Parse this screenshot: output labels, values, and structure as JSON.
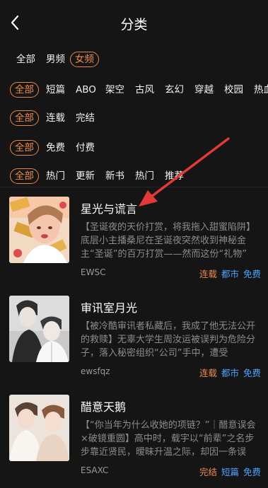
{
  "header": {
    "title": "分类",
    "back_icon": "chevron-left-icon"
  },
  "filters": {
    "gender": [
      "全部",
      "男频",
      "女频"
    ],
    "genre": [
      "全部",
      "短篇",
      "ABO",
      "架空",
      "古风",
      "玄幻",
      "穿越",
      "校园",
      "热血"
    ],
    "status": [
      "全部",
      "连载",
      "完结"
    ],
    "price": [
      "全部",
      "免费",
      "付费"
    ],
    "sort": [
      "全部",
      "热门",
      "更新",
      "新书",
      "热门",
      "推荐"
    ]
  },
  "books": [
    {
      "title": "星光与谎言",
      "desc": "【圣诞夜的天价打赏，将我拖入甜蜜陷阱】底层小主播桑尼在圣诞夜突然收到神秘金主“圣诞”的百万打赏——然而这份“礼物”",
      "author": "EWSC",
      "tags": [
        "连载",
        "都市",
        "免费"
      ]
    },
    {
      "title": "审讯室月光",
      "desc": "【被冷酷审讯者私藏后，我成了他无法公开的救赎】无辜大学生周汝运被误判为危险分子，落入秘密组织“公司”手中，遭受",
      "author": "ewsfqz",
      "tags": [
        "连载",
        "都市",
        "免费"
      ]
    },
    {
      "title": "醋意天鹅",
      "desc": "【“你当年为什么收她的项链？”｜醋意误会×破镜重圆】高中时，载宇以“前辈”之名步步靠近贤民，暧昧升温之际，却因一条误",
      "author": "ESAXC",
      "tags": [
        "完结",
        "短篇",
        "免费"
      ]
    }
  ],
  "colors": {
    "accent": "#f08a4b",
    "tag_blue": "#4aa5ff",
    "background": "#151515"
  }
}
